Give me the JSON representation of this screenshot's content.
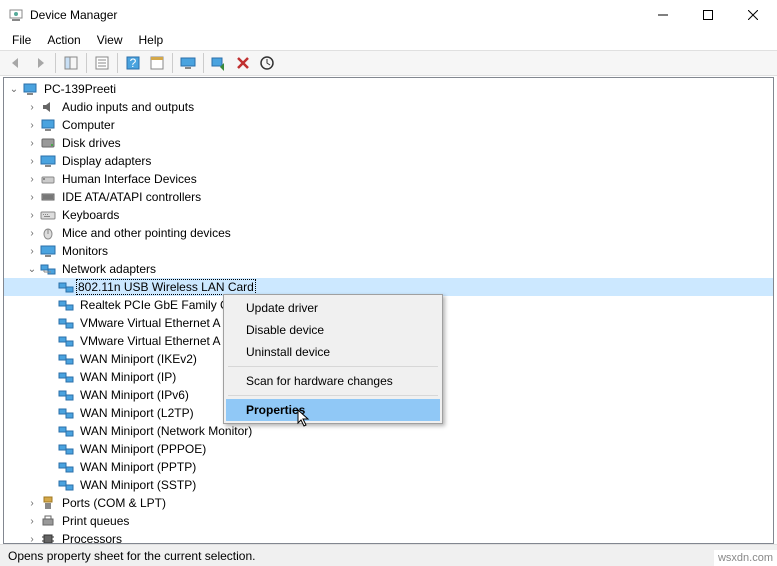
{
  "window": {
    "title": "Device Manager"
  },
  "menu": {
    "file": "File",
    "action": "Action",
    "view": "View",
    "help": "Help"
  },
  "tree": {
    "root": "PC-139Preeti",
    "categories": [
      "Audio inputs and outputs",
      "Computer",
      "Disk drives",
      "Display adapters",
      "Human Interface Devices",
      "IDE ATA/ATAPI controllers",
      "Keyboards",
      "Mice and other pointing devices",
      "Monitors",
      "Network adapters",
      "Ports (COM & LPT)",
      "Print queues",
      "Processors"
    ],
    "network_adapters": [
      "802.11n USB Wireless LAN Card",
      "Realtek PCIe GbE Family C",
      "VMware Virtual Ethernet A",
      "VMware Virtual Ethernet A",
      "WAN Miniport (IKEv2)",
      "WAN Miniport (IP)",
      "WAN Miniport (IPv6)",
      "WAN Miniport (L2TP)",
      "WAN Miniport (Network Monitor)",
      "WAN Miniport (PPPOE)",
      "WAN Miniport (PPTP)",
      "WAN Miniport (SSTP)"
    ]
  },
  "context_menu": {
    "update": "Update driver",
    "disable": "Disable device",
    "uninstall": "Uninstall device",
    "scan": "Scan for hardware changes",
    "properties": "Properties"
  },
  "status": "Opens property sheet for the current selection.",
  "watermark": "wsxdn.com"
}
